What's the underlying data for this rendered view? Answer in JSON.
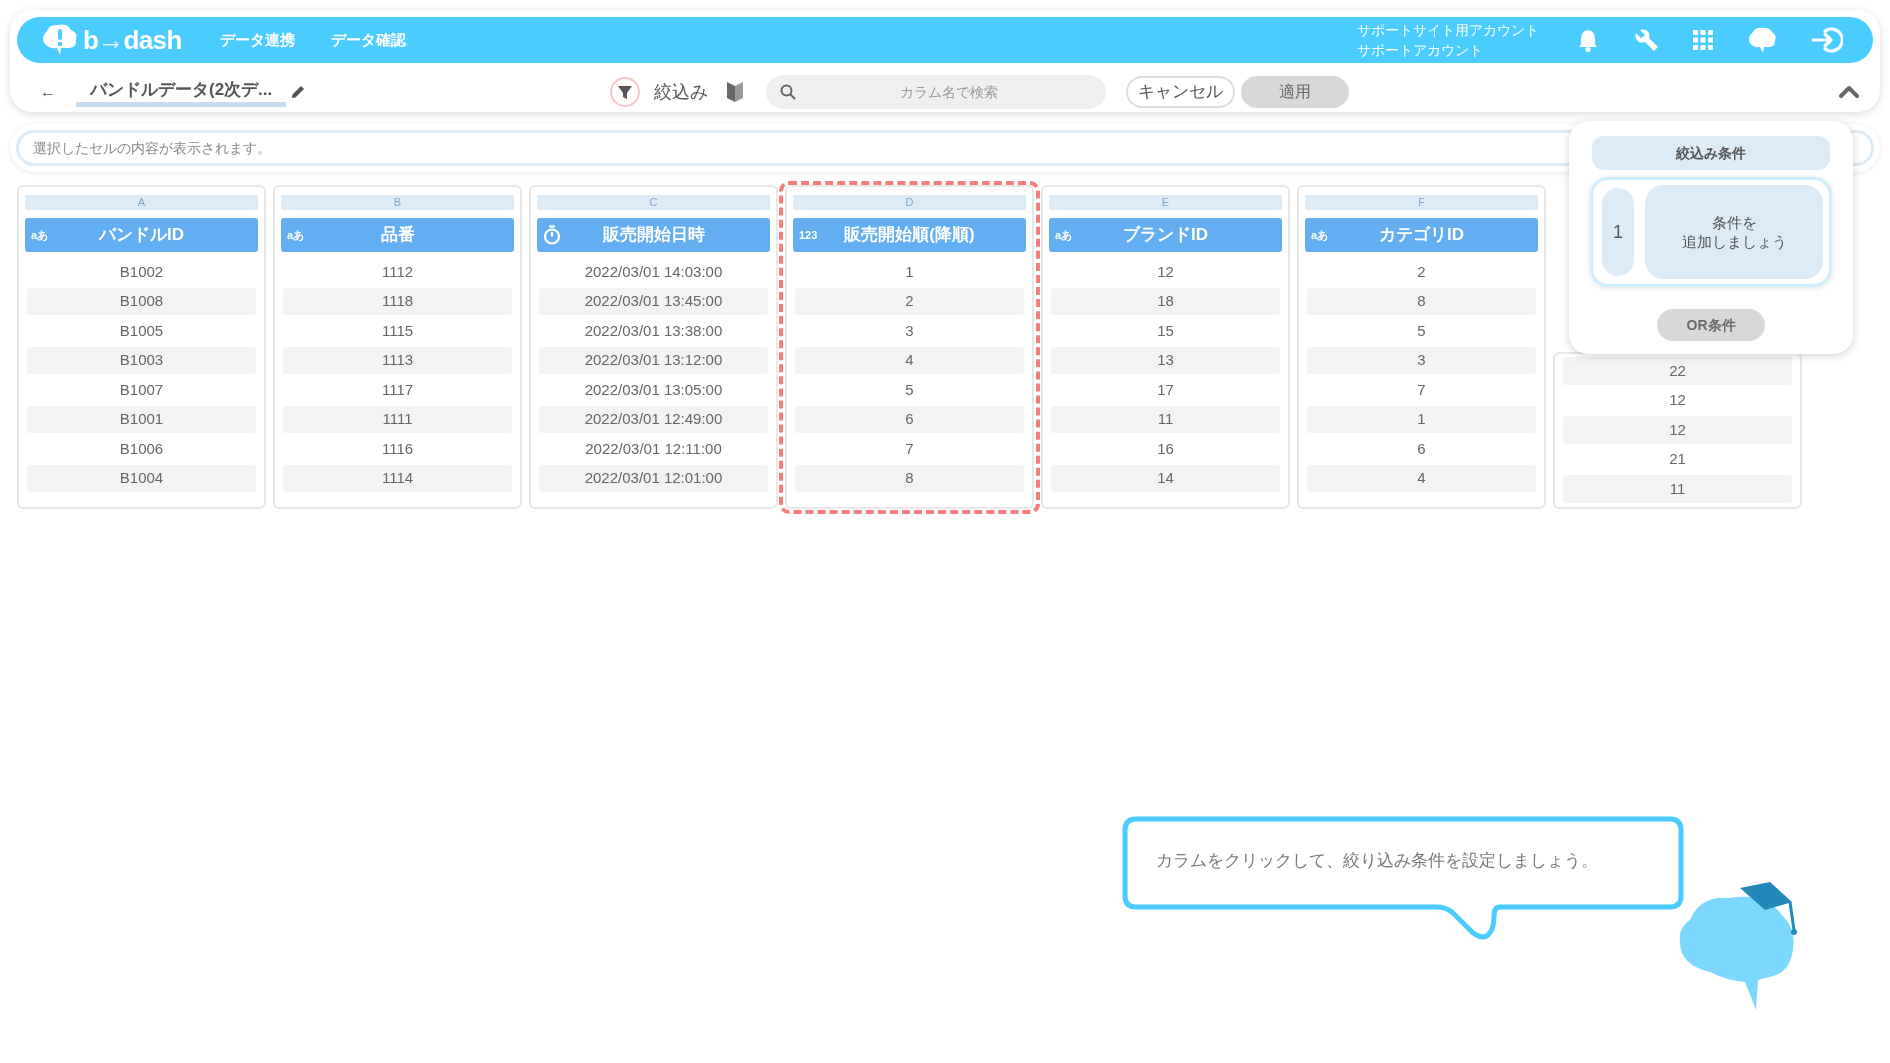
{
  "header": {
    "logo_text": "b→dash",
    "nav": [
      {
        "label": "データ連携"
      },
      {
        "label": "データ確認"
      }
    ],
    "account": [
      "サポートサイト用アカウント",
      "サポートアカウント"
    ]
  },
  "toolbar": {
    "back": "←",
    "title": "バンドルデータ(2次デ...",
    "filter_label": "絞込み",
    "search": {
      "placeholder": "カラム名で検索"
    },
    "cancel": "キャンセル",
    "apply": {
      "label": "適用",
      "disabled": true
    }
  },
  "cell_viewer": {
    "placeholder": "選択したセルの内容が表示されます。"
  },
  "columns": [
    {
      "letter": "A",
      "title": "バンドルID",
      "kind": "text",
      "type_icon": "aあ",
      "selected": false,
      "cells": [
        "B1002",
        "B1008",
        "B1005",
        "B1003",
        "B1007",
        "B1001",
        "B1006",
        "B1004"
      ]
    },
    {
      "letter": "B",
      "title": "品番",
      "kind": "text",
      "type_icon": "aあ",
      "selected": false,
      "cells": [
        "1112",
        "1118",
        "1115",
        "1113",
        "1117",
        "1111",
        "1116",
        "1114"
      ]
    },
    {
      "letter": "C",
      "title": "販売開始日時",
      "kind": "datetime",
      "selected": false,
      "cells": [
        "2022/03/01 14:03:00",
        "2022/03/01 13:45:00",
        "2022/03/01 13:38:00",
        "2022/03/01 13:12:00",
        "2022/03/01 13:05:00",
        "2022/03/01 12:49:00",
        "2022/03/01 12:11:00",
        "2022/03/01 12:01:00"
      ]
    },
    {
      "letter": "D",
      "title": "販売開始順(降順)",
      "kind": "number",
      "type_icon": "123",
      "selected": true,
      "cells": [
        "1",
        "2",
        "3",
        "4",
        "5",
        "6",
        "7",
        "8"
      ]
    },
    {
      "letter": "E",
      "title": "ブランドID",
      "kind": "text",
      "type_icon": "aあ",
      "selected": false,
      "cells": [
        "12",
        "18",
        "15",
        "13",
        "17",
        "11",
        "16",
        "14"
      ]
    },
    {
      "letter": "F",
      "title": "カテゴリID",
      "kind": "text",
      "type_icon": "aあ",
      "selected": false,
      "cells": [
        "2",
        "8",
        "5",
        "3",
        "7",
        "1",
        "6",
        "4"
      ]
    },
    {
      "kind": "partial",
      "selected": false,
      "cells": [
        "22",
        "12",
        "12",
        "21",
        "11"
      ]
    }
  ],
  "filter_panel": {
    "title": "絞込み条件",
    "group_number": "1",
    "hint": [
      "条件を",
      "追加しましょう"
    ],
    "or_button": "OR条件"
  },
  "tooltip": {
    "text": "カラムをクリックして、絞り込み条件を設定しましょう。"
  }
}
